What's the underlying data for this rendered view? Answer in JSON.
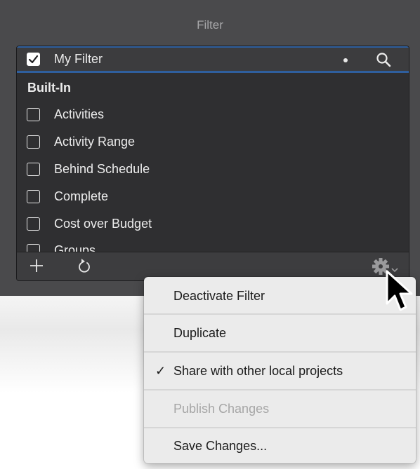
{
  "panel": {
    "title": "Filter"
  },
  "filters": {
    "selected": {
      "label": "My Filter",
      "checked": true
    },
    "section_header": "Built-In",
    "items": [
      {
        "label": "Activities",
        "checked": false
      },
      {
        "label": "Activity Range",
        "checked": false
      },
      {
        "label": "Behind Schedule",
        "checked": false
      },
      {
        "label": "Complete",
        "checked": false
      },
      {
        "label": "Cost over Budget",
        "checked": false
      },
      {
        "label": "Groups",
        "checked": false
      }
    ]
  },
  "toolbar": {
    "add_icon": "plus-icon",
    "refresh_icon": "refresh-icon",
    "actions_icon": "gear-icon"
  },
  "menu": {
    "items": [
      {
        "label": "Deactivate Filter",
        "checked": false,
        "enabled": true
      },
      {
        "label": "Duplicate",
        "checked": false,
        "enabled": true
      },
      {
        "label": "Share with other local projects",
        "checked": true,
        "check_glyph": "✓",
        "enabled": true
      },
      {
        "label": "Publish Changes",
        "checked": false,
        "enabled": false
      },
      {
        "label": "Save Changes...",
        "checked": false,
        "enabled": true
      }
    ]
  }
}
